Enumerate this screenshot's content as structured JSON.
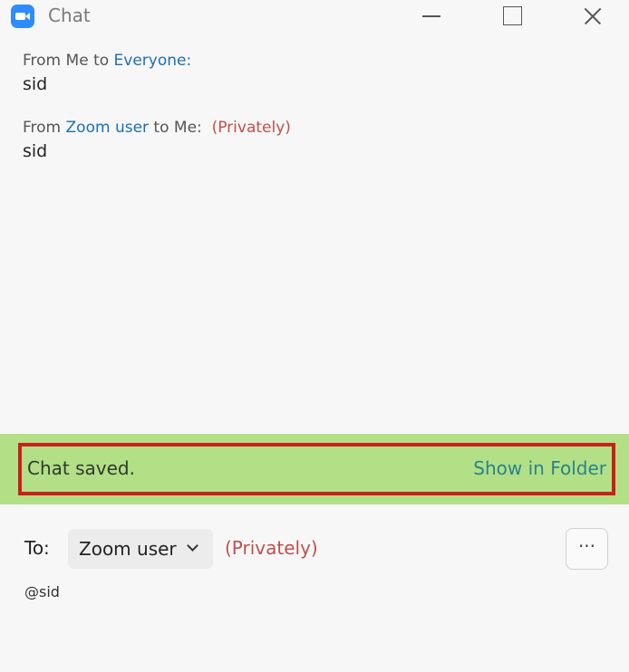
{
  "window": {
    "title": "Chat"
  },
  "messages": [
    {
      "from_prefix": "From ",
      "from": "Me",
      "to_word": " to ",
      "to": "Everyone",
      "suffix": ":",
      "text": "sid"
    },
    {
      "from_prefix": "From ",
      "from": "Zoom user",
      "to_word": " to ",
      "to": "Me",
      "suffix": ":",
      "tag": "(Privately)",
      "text": "sid"
    }
  ],
  "notice": {
    "text": "Chat saved.",
    "link": "Show in Folder"
  },
  "composer": {
    "to_label": "To:",
    "recipient": "Zoom user",
    "privately": "(Privately)",
    "more_label": "···",
    "input_text": "@sid"
  },
  "colors": {
    "link": "#1b6fb5",
    "private": "#c0504d",
    "notice_bg": "#b3df86",
    "highlight_border": "#c9201d",
    "app_icon": "#2d8cff"
  }
}
